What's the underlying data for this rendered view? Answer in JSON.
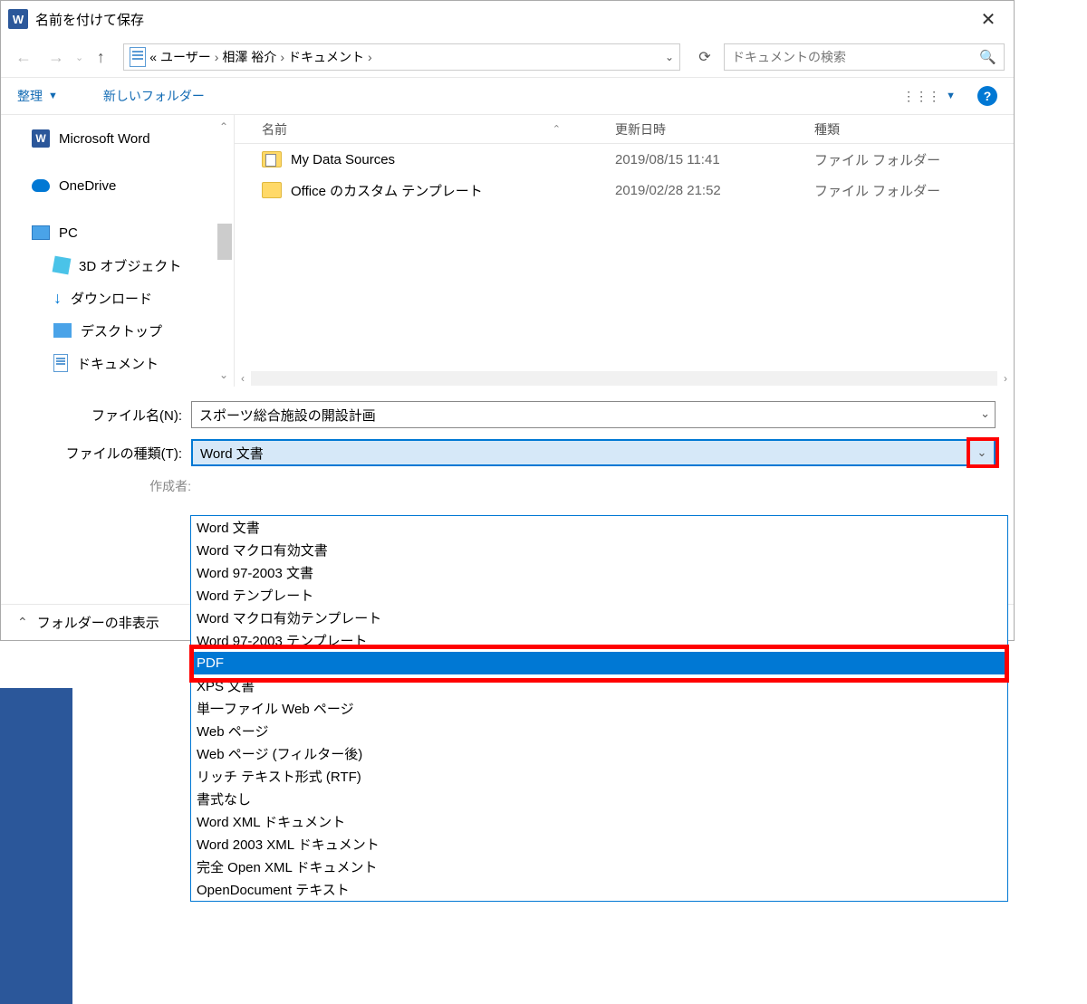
{
  "window": {
    "title": "名前を付けて保存"
  },
  "nav": {
    "breadcrumb": [
      "ユーザー",
      "相澤 裕介",
      "ドキュメント"
    ],
    "search_placeholder": "ドキュメントの検索"
  },
  "toolbar": {
    "organize": "整理",
    "new_folder": "新しいフォルダー"
  },
  "sidebar": {
    "word": "Microsoft Word",
    "onedrive": "OneDrive",
    "pc": "PC",
    "objects3d": "3D オブジェクト",
    "downloads": "ダウンロード",
    "desktop": "デスクトップ",
    "documents": "ドキュメント"
  },
  "columns": {
    "name": "名前",
    "date": "更新日時",
    "type": "種類"
  },
  "files": [
    {
      "name": "My Data Sources",
      "date": "2019/08/15 11:41",
      "type": "ファイル フォルダー"
    },
    {
      "name": "Office のカスタム テンプレート",
      "date": "2019/02/28 21:52",
      "type": "ファイル フォルダー"
    }
  ],
  "form": {
    "filename_label": "ファイル名(N):",
    "filename_value": "スポーツ総合施設の開設計画",
    "filetype_label": "ファイルの種類(T):",
    "filetype_value": "Word 文書",
    "author_label": "作成者:"
  },
  "hide_folders": "フォルダーの非表示",
  "filetype_options": [
    "Word 文書",
    "Word マクロ有効文書",
    "Word 97-2003 文書",
    "Word テンプレート",
    "Word マクロ有効テンプレート",
    "Word 97-2003 テンプレート",
    "PDF",
    "XPS 文書",
    "単一ファイル Web ページ",
    "Web ページ",
    "Web ページ (フィルター後)",
    "リッチ テキスト形式 (RTF)",
    "書式なし",
    "Word XML ドキュメント",
    "Word 2003 XML ドキュメント",
    "完全 Open XML ドキュメント",
    "OpenDocument テキスト"
  ],
  "selected_filetype_index": 6
}
